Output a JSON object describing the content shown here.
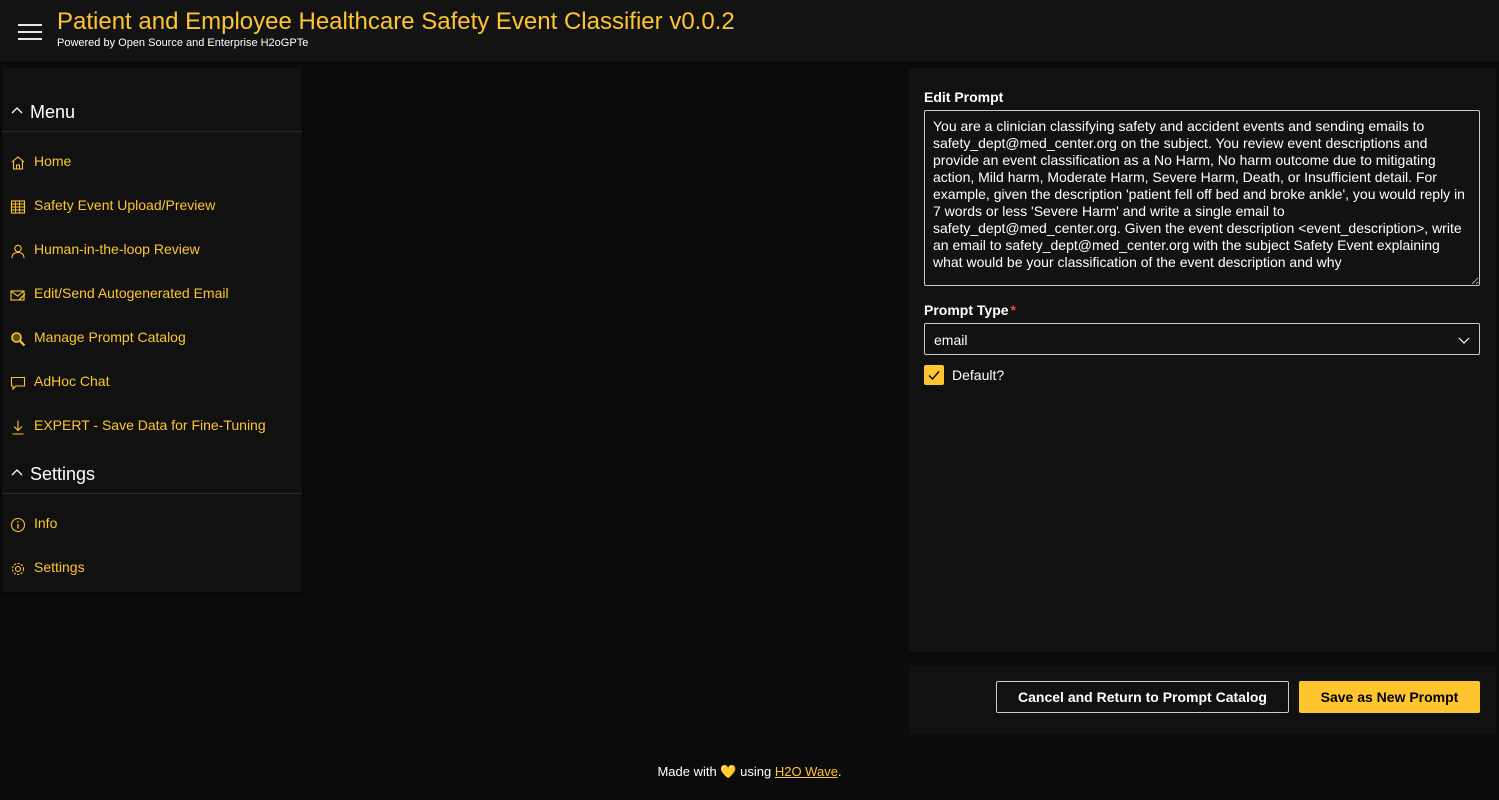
{
  "header": {
    "title": "Patient and Employee Healthcare Safety Event Classifier v0.0.2",
    "subtitle": "Powered by Open Source and Enterprise H2oGPTe"
  },
  "sidebar": {
    "menu_group": "Menu",
    "menu_items": [
      {
        "label": "Home",
        "icon": "home-icon"
      },
      {
        "label": "Safety Event Upload/Preview",
        "icon": "table-icon"
      },
      {
        "label": "Human-in-the-loop Review",
        "icon": "person-icon"
      },
      {
        "label": "Edit/Send Autogenerated Email",
        "icon": "mail-edit-icon"
      },
      {
        "label": "Manage Prompt Catalog",
        "icon": "search-catalog-icon"
      },
      {
        "label": "AdHoc Chat",
        "icon": "chat-icon"
      },
      {
        "label": "EXPERT - Save Data for Fine-Tuning",
        "icon": "download-icon"
      }
    ],
    "settings_group": "Settings",
    "settings_items": [
      {
        "label": "Info",
        "icon": "info-icon"
      },
      {
        "label": "Settings",
        "icon": "gear-icon"
      }
    ]
  },
  "form": {
    "edit_prompt_label": "Edit Prompt",
    "edit_prompt_value": "You are a clinician classifying safety and accident events and sending emails to safety_dept@med_center.org on the subject. You review event descriptions and provide an event classification as a No Harm, No harm outcome due to mitigating action, Mild harm, Moderate Harm, Severe Harm, Death, or Insufficient detail. For example, given the description 'patient fell off bed and broke ankle', you would reply in 7 words or less 'Severe Harm' and write a single email to safety_dept@med_center.org. Given the event description <event_description>, write an email to safety_dept@med_center.org with the subject Safety Event explaining what would be your classification of the event description and why",
    "prompt_type_label": "Prompt Type",
    "required_marker": "*",
    "prompt_type_value": "email",
    "default_label": "Default?",
    "default_checked": true
  },
  "buttons": {
    "cancel_label": "Cancel and Return to Prompt Catalog",
    "save_label": "Save as New Prompt"
  },
  "footer": {
    "made_with": "Made with",
    "heart": "💛",
    "using": "using",
    "link_text": "H2O Wave",
    "period": "."
  },
  "colors": {
    "accent": "#fec52e",
    "background": "#0b0b0b",
    "card": "#111111"
  }
}
